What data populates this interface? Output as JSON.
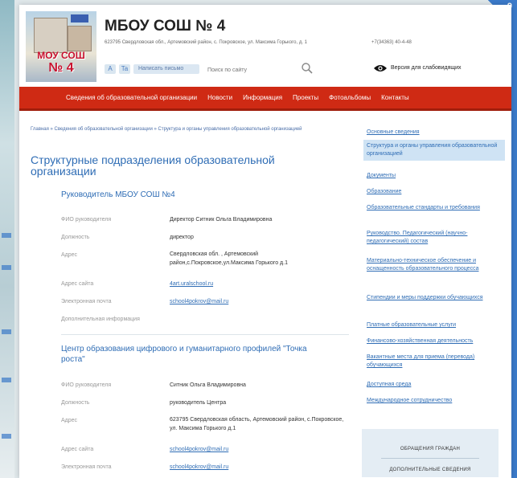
{
  "corner_badge": "9",
  "header": {
    "logo_line1": "МОУ СОШ",
    "logo_line2": "№ 4",
    "school_title": "МБОУ СОШ № 4",
    "address": "623795 Свердловская обл., Артемовский район, с. Покровское, ул. Максима Горького, д. 1",
    "phone": "+7(34363) 40-4-48",
    "toolbar_icon_1": "A",
    "toolbar_icon_2": "Ta",
    "write_letter": "Написать письмо",
    "search_placeholder": "Поиск по сайту",
    "low_vision_label": "Версия для слабовидящих"
  },
  "nav": {
    "items": [
      "Сведения об образовательной организации",
      "Новости",
      "Информация",
      "Проекты",
      "Фотоальбомы",
      "Контакты"
    ]
  },
  "breadcrumb": "Главная » Сведения об образовательной организации » Структура и органы управления образовательной организацией",
  "page_title": "Структурные подразделения образовательной организации",
  "sections": [
    {
      "title": "Руководитель МБОУ СОШ №4",
      "rows": [
        {
          "label": "ФИО руководителя",
          "value": "Директор Ситник Ольга Владимировна"
        },
        {
          "label": "Должность",
          "value": "директор"
        },
        {
          "label": "Адрес",
          "value": "Свердловская обл. , Артемовский район,с.Покровское,ул.Максима Горького д.1"
        },
        {
          "label": "Адрес сайта",
          "value": "4art.uralschool.ru"
        },
        {
          "label": "Электронная почта",
          "value": "school4pokrov@mail.ru"
        },
        {
          "label": "Дополнительная информация",
          "value": ""
        }
      ]
    },
    {
      "title": "Центр образования цифрового и гуманитарного профилей \"Точка роста\"",
      "rows": [
        {
          "label": "ФИО руководителя",
          "value": "Ситник Ольга Владимировна"
        },
        {
          "label": "Должность",
          "value": "руководитель Центра"
        },
        {
          "label": "Адрес",
          "value": "623795 Свердловская область, Артемовский район, с.Покровское, ул. Максима Горького д.1"
        },
        {
          "label": "Адрес сайта",
          "value": "school4pokrov@mail.ru"
        },
        {
          "label": "Электронная почта",
          "value": "school4pokrov@mail.ru"
        }
      ]
    }
  ],
  "sidebar": {
    "items": [
      "Основные сведения",
      "Структура и органы управления образовательной организацией",
      "Документы",
      "Образование",
      "Образовательные стандарты и требования",
      "Руководство. Педагогический (научно-педагогический) состав",
      "Материально-техническое обеспечение и оснащенность образовательного процесса",
      "Стипендии и меры поддержки обучающихся",
      "Платные образовательные услуги",
      "Финансово-хозяйственная деятельность",
      "Вакантные места для приема (перевода) обучающихся",
      "Доступная среда",
      "Международное сотрудничество"
    ],
    "buttons": [
      "ОБРАЩЕНИЯ ГРАЖДАН",
      "ДОПОЛНИТЕЛЬНЫЕ СВЕДЕНИЯ"
    ]
  }
}
